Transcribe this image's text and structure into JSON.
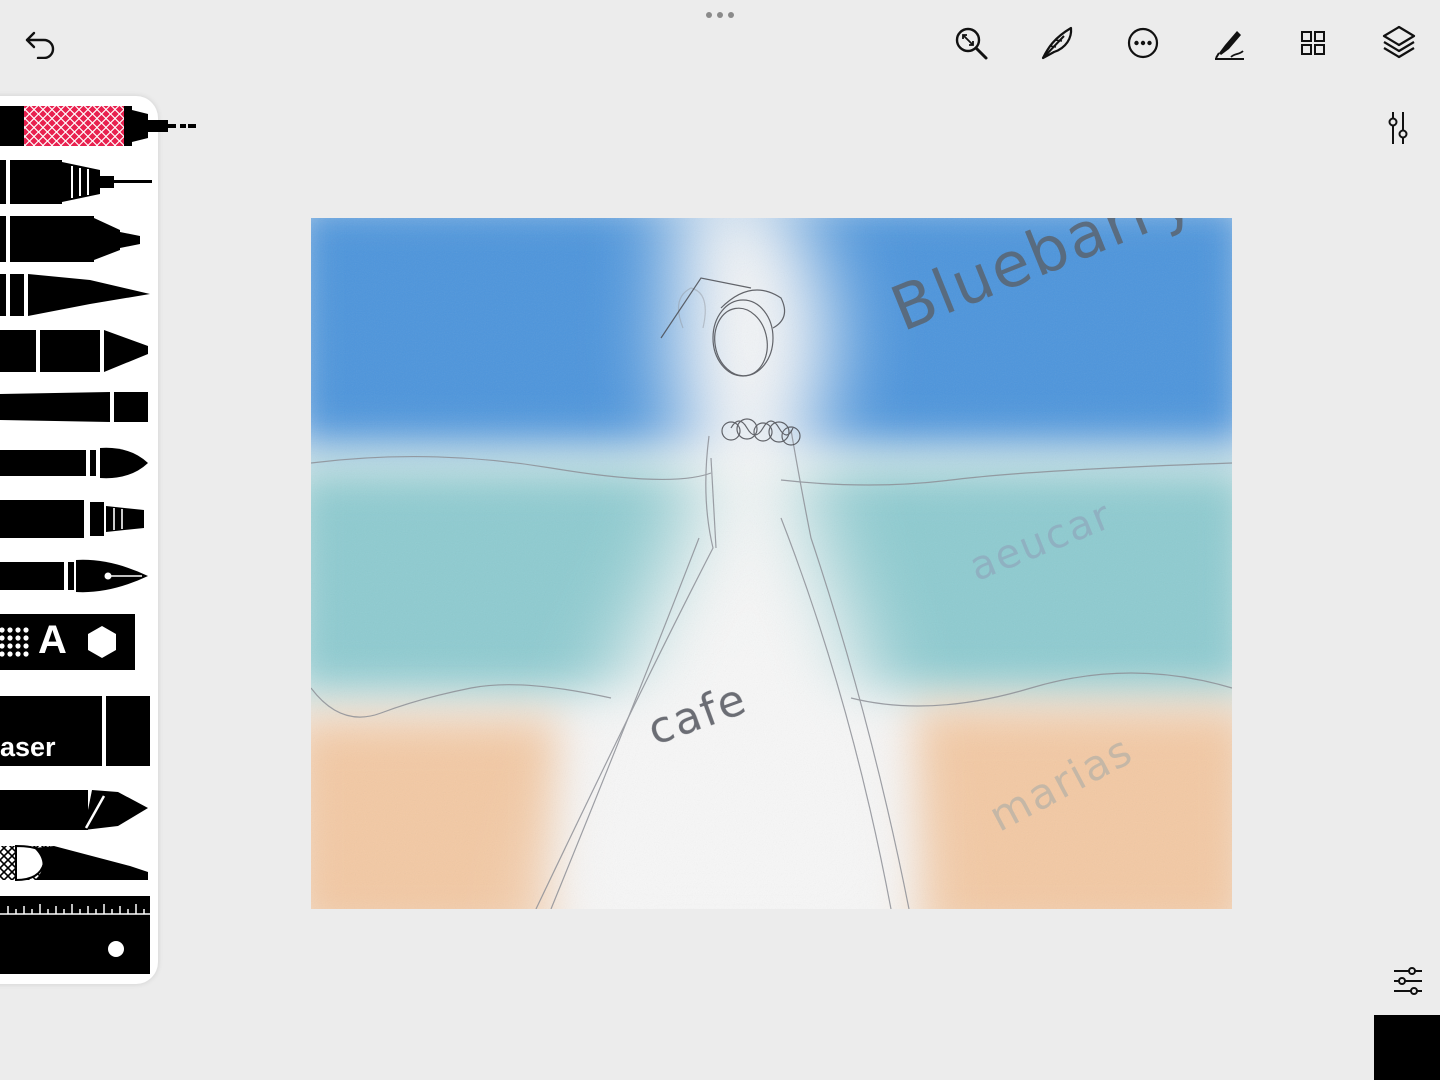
{
  "toolbar": {
    "undo_icon": "undo-icon",
    "more_dots_icon": "drag-handle-dots-icon",
    "right_icons": [
      "zoom-fit-icon",
      "feather-icon",
      "more-options-icon",
      "pen-settings-icon",
      "grid-icon",
      "layers-icon"
    ]
  },
  "tray": {
    "eraser_label": "aser",
    "text_tool_glyph": "A"
  },
  "canvas": {
    "words": {
      "top_right": "Bluebarrys",
      "middle_right": "aeucar",
      "bottom_left_center": "cafe",
      "bottom_right": "marias"
    },
    "colors": {
      "sky": "#4e95dc",
      "sea": "#8ecbd0",
      "sand": "#f3c9a4",
      "paper": "#f5f5f5"
    }
  },
  "side": {
    "adjust_icon": "adjustments-icon",
    "sliders_icon": "sliders-icon"
  },
  "current_color": "#000000"
}
